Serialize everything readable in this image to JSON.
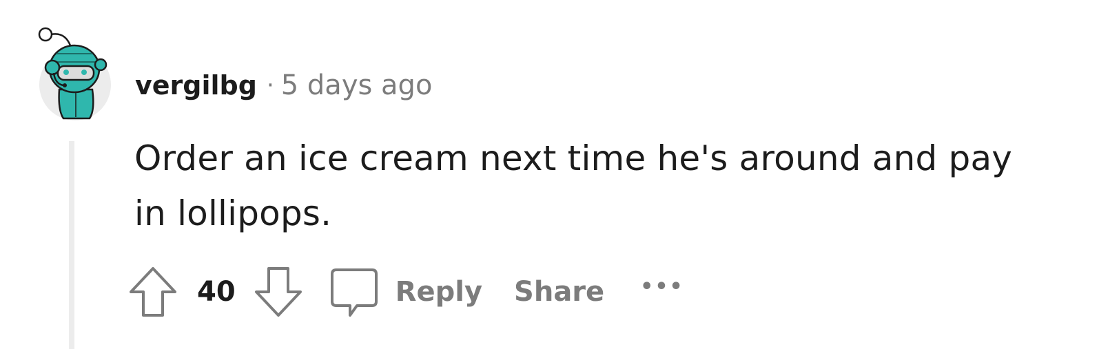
{
  "comment": {
    "author": "vergilbg",
    "separator": "·",
    "timestamp": "5 days ago",
    "body": "Order an ice cream next time he's around and pay in lollipops.",
    "score": "40"
  },
  "actions": {
    "reply_label": "Reply",
    "share_label": "Share",
    "more_label": "•••"
  },
  "icons": {
    "upvote": "arrow-up-outline",
    "downvote": "arrow-down-outline",
    "reply": "speech-bubble-outline",
    "avatar": "teal-helmet-snoo"
  },
  "colors": {
    "avatar_primary": "#2fb7ad",
    "text_primary": "#1c1c1c",
    "text_muted": "#7c7c7c",
    "thread_line": "#ececec"
  }
}
